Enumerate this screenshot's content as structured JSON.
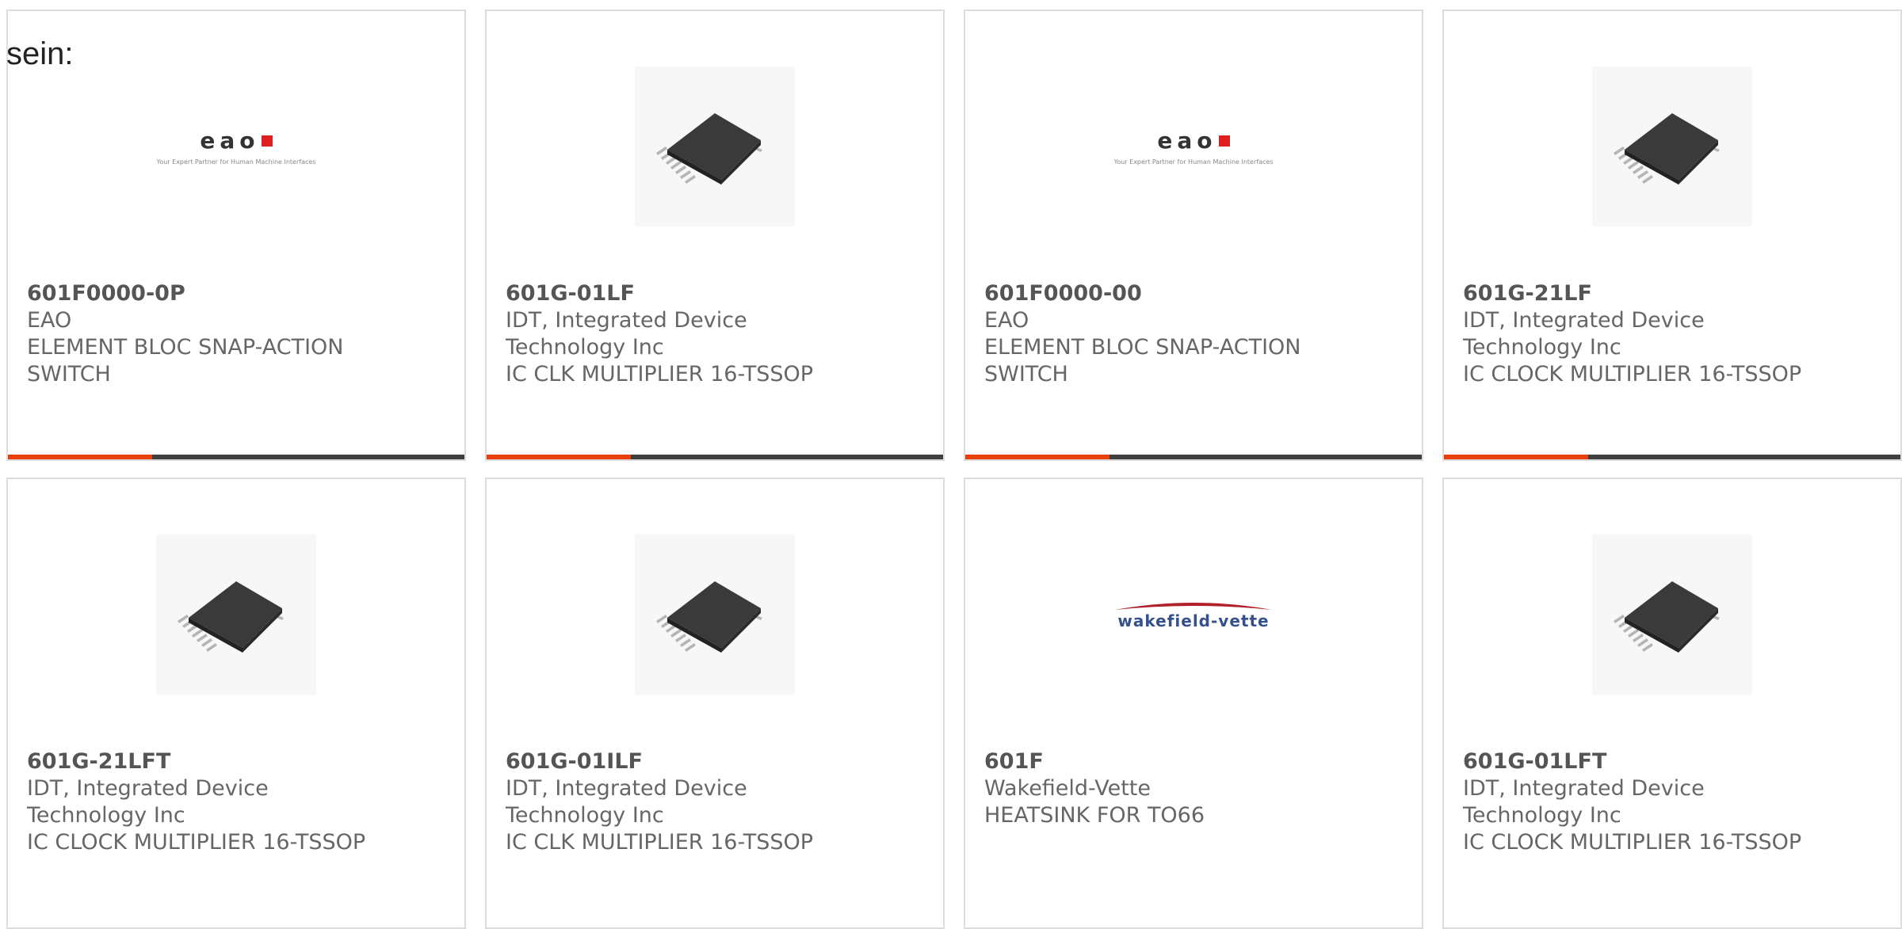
{
  "intro_text": "sein:",
  "colors": {
    "accent": "#e8400c",
    "bar_dark": "#3f3f3f",
    "eao_red": "#e02020",
    "wakefield_blue": "#35508a",
    "wakefield_red": "#b0202a"
  },
  "products": [
    {
      "part_number": "601F0000-0P",
      "manufacturer_lines": [
        "EAO"
      ],
      "description_lines": [
        "ELEMENT BLOC SNAP-ACTION",
        "SWITCH"
      ],
      "image": "eao-logo",
      "logo": {
        "mark": "eao",
        "tagline": "Your Expert Partner for Human Machine Interfaces"
      }
    },
    {
      "part_number": "601G-01LF",
      "manufacturer_lines": [
        "IDT, Integrated Device",
        "Technology Inc"
      ],
      "description_lines": [
        "IC CLK MULTIPLIER 16-TSSOP"
      ],
      "image": "tssop-chip"
    },
    {
      "part_number": "601F0000-00",
      "manufacturer_lines": [
        "EAO"
      ],
      "description_lines": [
        "ELEMENT BLOC SNAP-ACTION",
        "SWITCH"
      ],
      "image": "eao-logo",
      "logo": {
        "mark": "eao",
        "tagline": "Your Expert Partner for Human Machine Interfaces"
      }
    },
    {
      "part_number": "601G-21LF",
      "manufacturer_lines": [
        "IDT, Integrated Device",
        "Technology Inc"
      ],
      "description_lines": [
        "IC CLOCK MULTIPLIER 16-TSSOP"
      ],
      "image": "tssop-chip"
    },
    {
      "part_number": "601G-21LFT",
      "manufacturer_lines": [
        "IDT, Integrated Device",
        "Technology Inc"
      ],
      "description_lines": [
        "IC CLOCK MULTIPLIER 16-TSSOP"
      ],
      "image": "tssop-chip"
    },
    {
      "part_number": "601G-01ILF",
      "manufacturer_lines": [
        "IDT, Integrated Device",
        "Technology Inc"
      ],
      "description_lines": [
        "IC CLK MULTIPLIER 16-TSSOP"
      ],
      "image": "tssop-chip"
    },
    {
      "part_number": "601F",
      "manufacturer_lines": [
        "Wakefield-Vette"
      ],
      "description_lines": [
        "HEATSINK FOR TO66"
      ],
      "image": "wakefield-vette-logo",
      "logo": {
        "mark": "wakefield-vette"
      }
    },
    {
      "part_number": "601G-01LFT",
      "manufacturer_lines": [
        "IDT, Integrated Device",
        "Technology Inc"
      ],
      "description_lines": [
        "IC CLOCK MULTIPLIER 16-TSSOP"
      ],
      "image": "tssop-chip"
    }
  ]
}
